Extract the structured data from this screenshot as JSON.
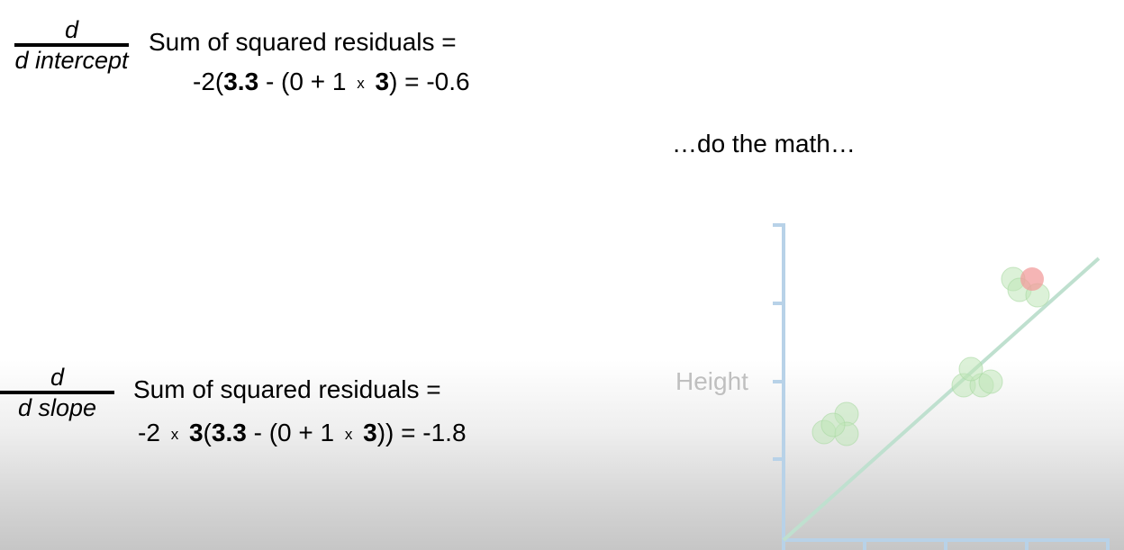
{
  "eq_intercept": {
    "numerator": "d",
    "denominator": "d intercept",
    "label": "Sum of squared residuals =",
    "parts": [
      "-2(",
      "3.3",
      " - (0 + 1 ",
      "x",
      " ",
      "3",
      ") = -0.6"
    ]
  },
  "eq_slope": {
    "numerator": "d",
    "denominator": "d slope",
    "label": "Sum of squared residuals =",
    "parts": [
      "-2 ",
      "x",
      " ",
      "3",
      "(",
      "3.3",
      " - (0 + 1 ",
      "x",
      " ",
      "3",
      ")) = -1.8"
    ]
  },
  "aside": "…do the math…",
  "plot": {
    "ylabel": "Height",
    "colors": {
      "axis": "#b8d2e8",
      "line": "#bfe0cf",
      "point": "#bfe6b8",
      "highlight": "#f29c9c"
    }
  }
}
